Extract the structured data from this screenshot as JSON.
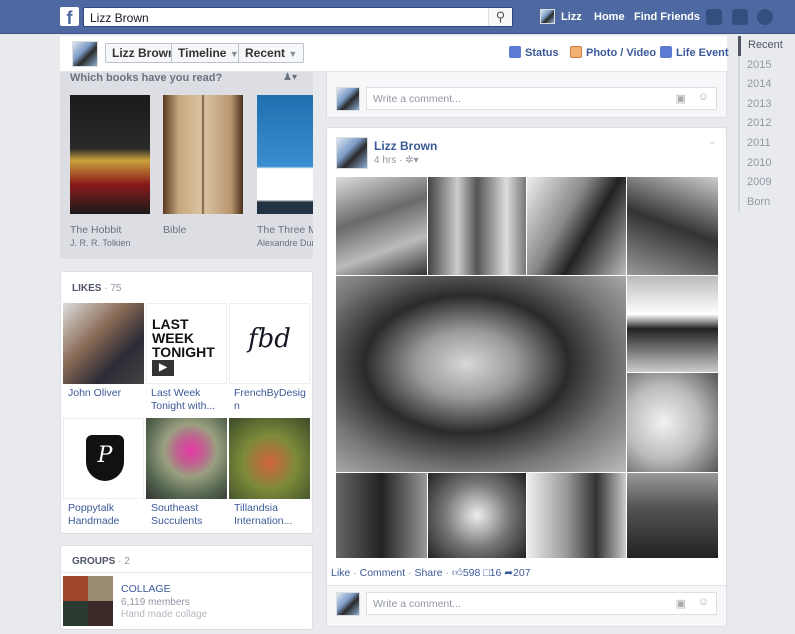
{
  "topbar": {
    "search_value": "Lizz Brown",
    "user_name": "Lizz",
    "home": "Home",
    "find_friends": "Find Friends"
  },
  "header": {
    "name": "Lizz Brown",
    "timeline": "Timeline",
    "recent": "Recent",
    "status": "Status",
    "photo_video": "Photo / Video",
    "life_event": "Life Event"
  },
  "year_nav": [
    "Recent",
    "2015",
    "2014",
    "2013",
    "2012",
    "2011",
    "2010",
    "2009",
    "Born"
  ],
  "books": {
    "title": "Which books have you read?",
    "items": [
      {
        "title": "The Hobbit",
        "author": "J. R. R. Tolkien"
      },
      {
        "title": "Bible",
        "author": ""
      },
      {
        "title": "The Three Mu",
        "author": "Alexandre Dum"
      }
    ]
  },
  "likes": {
    "title": "LIKES",
    "count": "75",
    "items": [
      {
        "label": "John Oliver"
      },
      {
        "label": "Last Week Tonight with..."
      },
      {
        "label": "FrenchByDesign"
      },
      {
        "label": "Poppytalk Handmade"
      },
      {
        "label": "Southeast Succulents"
      },
      {
        "label": "Tillandsia Internation..."
      }
    ]
  },
  "groups": {
    "title": "GROUPS",
    "count": "2",
    "name": "COLLAGE",
    "members": "6,119 members",
    "description": "Hand made collage"
  },
  "comment_placeholder": "Write a comment...",
  "post": {
    "author": "Lizz Brown",
    "time": "4 hrs",
    "like": "Like",
    "comment": "Comment",
    "share": "Share",
    "likes_count": "598",
    "comments_count": "16",
    "shares_count": "207"
  },
  "colors": {
    "topbar": "#4e69a2",
    "link": "#3b5998",
    "background": "#e9eaed"
  }
}
